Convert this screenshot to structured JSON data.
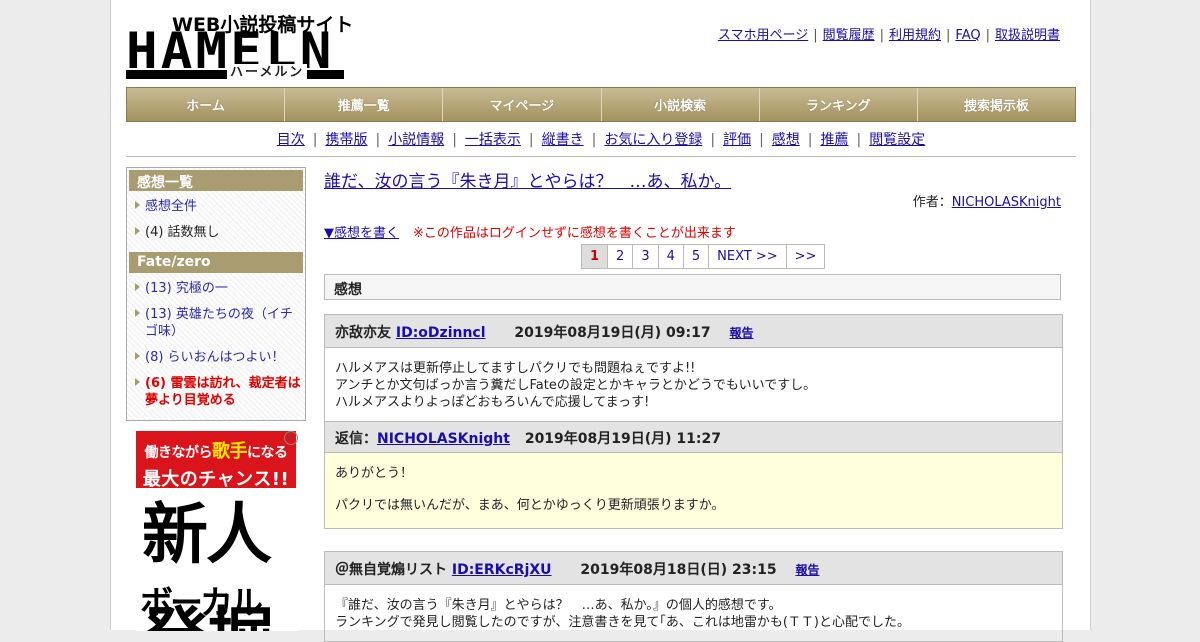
{
  "logo": {
    "tagline": "WEB小説投稿サイト",
    "wordmark": "HAMELN",
    "kana": "ハーメルン"
  },
  "top_links": [
    "スマホ用ページ",
    "閲覧履歴",
    "利用規約",
    "FAQ",
    "取扱説明書"
  ],
  "nav": [
    "ホーム",
    "推薦一覧",
    "マイページ",
    "小説検索",
    "ランキング",
    "捜索掲示板"
  ],
  "subnav": [
    "目次",
    "携帯版",
    "小説情報",
    "一括表示",
    "縦書き",
    "お気に入り登録",
    "評価",
    "感想",
    "推薦",
    "閲覧設定"
  ],
  "sidebar": {
    "section1_title": "感想一覧",
    "section1_items": [
      {
        "label": "感想全件"
      },
      {
        "label": "(4) 話数無し"
      }
    ],
    "section2_title": "Fate/zero",
    "section2_items": [
      {
        "label": "(13) 究極の一"
      },
      {
        "label": "(13) 英雄たちの夜（イチゴ味）"
      },
      {
        "label": "(8) らいおんはつよい！"
      },
      {
        "label": "(6) 雷雲は訪れ、裁定者は夢より目覚める"
      }
    ]
  },
  "ad": {
    "line1_a": "働きながら",
    "line1_b": "歌手",
    "line1_c": "になる",
    "line2": "最大のチャンス!!",
    "big1": "新人",
    "big2": "ボーカル",
    "big3": "発掘",
    "info": "i"
  },
  "main": {
    "title": "誰だ、汝の言う『朱き月』とやらは？　…あ、私か。",
    "author_label": "作者：",
    "author": "NICHOLASKnight",
    "write_link": "▼感想を書く",
    "write_note": "※この作品はログインせずに感想を書くことが出来ます",
    "pager": [
      "1",
      "2",
      "3",
      "4",
      "5",
      "NEXT >>",
      ">>"
    ],
    "pager_current": "1",
    "section_title": "感想"
  },
  "reviews": [
    {
      "name": "亦敌亦友",
      "id": "ID:oDzinncl",
      "date": "2019年08月19日(月) 09:17",
      "report": "報告",
      "body": [
        "ハルメアスは更新停止してますしパクリでも問題ねぇですよ!!",
        "アンチとか文句ばっか言う糞だしFateの設定とかキャラとかどうでもいいですし。",
        "ハルメアスよりよっぽどおもろいんで応援してまっす!"
      ],
      "reply_label": "返信：",
      "reply_author": "NICHOLASKnight",
      "reply_date": "2019年08月19日(月) 11:27",
      "reply_body": [
        "ありがとう！",
        "パクリでは無いんだが、まあ、何とかゆっくり更新頑張りますか。"
      ]
    },
    {
      "name": "＠無自覚煽リスト",
      "id": "ID:ERKcRjXU",
      "date": "2019年08月18日(日) 23:15",
      "report": "報告",
      "body": [
        "『誰だ、汝の言う『朱き月』とやらは？　…あ、私か。』の個人的感想です。",
        "ランキングで発見し閲覧したのですが、注意書きを見て｢あ、これは地雷かも(ＴＴ)と心配でした。"
      ]
    }
  ]
}
